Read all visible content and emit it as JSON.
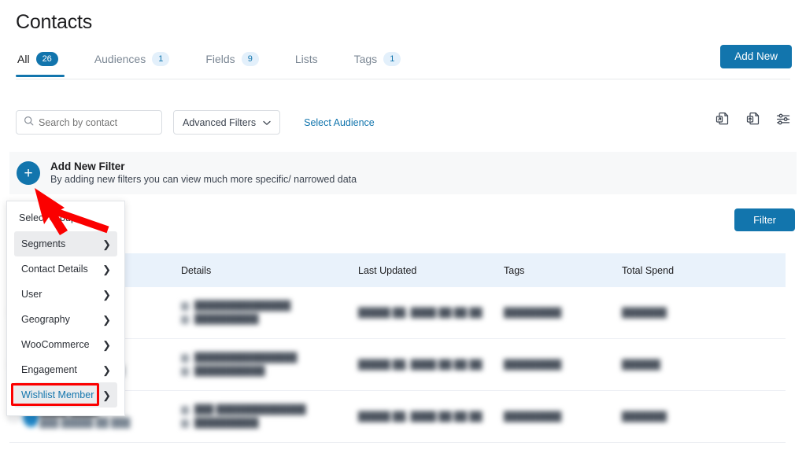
{
  "header": {
    "title": "Contacts",
    "add_new_label": "Add New"
  },
  "tabs": [
    {
      "label": "All",
      "badge": "26",
      "active": true
    },
    {
      "label": "Audiences",
      "badge": "1",
      "active": false
    },
    {
      "label": "Fields",
      "badge": "9",
      "active": false
    },
    {
      "label": "Lists",
      "badge": "",
      "active": false
    },
    {
      "label": "Tags",
      "badge": "1",
      "active": false
    }
  ],
  "toolbar": {
    "search_placeholder": "Search by contact",
    "search_value": "",
    "search_icon": "search-icon",
    "advanced_filters_label": "Advanced Filters",
    "advanced_filters_chevron": "chevron-down-icon",
    "select_audience_label": "Select Audience",
    "icons": [
      {
        "name": "export-contacts-icon"
      },
      {
        "name": "import-contacts-icon"
      },
      {
        "name": "table-settings-icon"
      }
    ]
  },
  "filter_panel": {
    "plus_icon": "plus-icon",
    "title": "Add New Filter",
    "subtitle": "By adding new filters you can view much more specific/ narrowed data"
  },
  "filter_button": {
    "label": "Filter"
  },
  "dropdown": {
    "title": "Select Group",
    "items": [
      {
        "label": "Segments",
        "state": "hover"
      },
      {
        "label": "Contact Details",
        "state": "normal"
      },
      {
        "label": "User",
        "state": "normal"
      },
      {
        "label": "Geography",
        "state": "normal"
      },
      {
        "label": "WooCommerce",
        "state": "normal"
      },
      {
        "label": "Engagement",
        "state": "normal"
      },
      {
        "label": "Wishlist Member",
        "state": "selected"
      }
    ],
    "chevron_icon": "chevron-right-icon"
  },
  "annotation": {
    "arrow_color": "#fb0000",
    "highlight_color": "#fb0000",
    "highlight_target": "Wishlist Member"
  },
  "table": {
    "columns": [
      "",
      "",
      "Details",
      "Last Updated",
      "Tags",
      "Total Spend"
    ],
    "rows": [
      {
        "name": "███ ███",
        "subtitle": "███ ████ ██ ██",
        "email": "███████████████",
        "phone": "██████████",
        "last_updated": "█████ ██, ████ ██:██ ██",
        "tags": "█████████",
        "total_spend": "███████"
      },
      {
        "name": "████ █████",
        "subtitle": "███ █████ █ ███",
        "email": "████████████████",
        "phone": "███████████",
        "last_updated": "█████ ██, ████ ██:██ ██",
        "tags": "█████████",
        "total_spend": "██████"
      },
      {
        "name": "████ ████",
        "subtitle": "███ █████ ██ ███",
        "email": "███ ██████████████",
        "phone": "██████████",
        "last_updated": "█████ ██, ████ ██:██ ██",
        "tags": "█████████",
        "total_spend": "███████"
      }
    ]
  }
}
